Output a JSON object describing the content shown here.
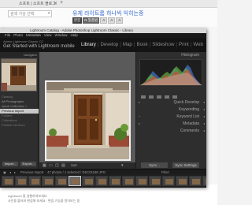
{
  "browser": {
    "url_text": "소프트 | 소프트 블로그",
    "search_placeholder": "검색 가상 선택",
    "blog_title": "유체 라이트룸 하나씩 익히는중",
    "blog_tools": [
      "본문",
      "N 맞춤법",
      "A",
      "A",
      "A"
    ],
    "bottom_lines": [
      "Lightroom 을 실행하여보세요",
      "사진을 불러와 편집해 보세요 · 편집 기능을 알아보는 중"
    ]
  },
  "lightroom": {
    "window_title": "Lightroom Catalog - Adobe Photoshop Lightroom Classic - Library",
    "menu": [
      "File",
      "Photo",
      "Metadata",
      "View",
      "Window",
      "Help"
    ],
    "brand": "Adobe Lightroom Classic CC",
    "started_text": "Get Started with Lightroom mobile",
    "modules": [
      "Library",
      "Develop",
      "Map",
      "Book",
      "Slideshow",
      "Print",
      "Web"
    ],
    "active_module": "Library",
    "left_panel": {
      "header": "Navigator",
      "rows": [
        "Catalog",
        "All Photographs",
        "Quick Collection +",
        "Previous Import",
        "Folders",
        "Collections",
        "Publish Services"
      ],
      "highlighted_row": "Previous Import",
      "buttons": [
        "Import...",
        "Export..."
      ]
    },
    "center_toolbar": {
      "view_icons": [
        "grid",
        "loupe",
        "compare",
        "survey"
      ],
      "sort_label": "Sort"
    },
    "right_panel": {
      "histogram_label": "Histogram",
      "sections": [
        "Quick Develop",
        "Keywording",
        "Keyword List",
        "Metadata",
        "Comments"
      ],
      "buttons": [
        "Sync...",
        "Sync Settings"
      ]
    },
    "filmbar": {
      "source": "Previous Import",
      "count_text": "47 photos / 1 selected / DSC01188.JPG",
      "filter_label": "Filter:"
    },
    "filmstrip": {
      "thumbnail_count": 16,
      "selected_index": 5
    }
  }
}
